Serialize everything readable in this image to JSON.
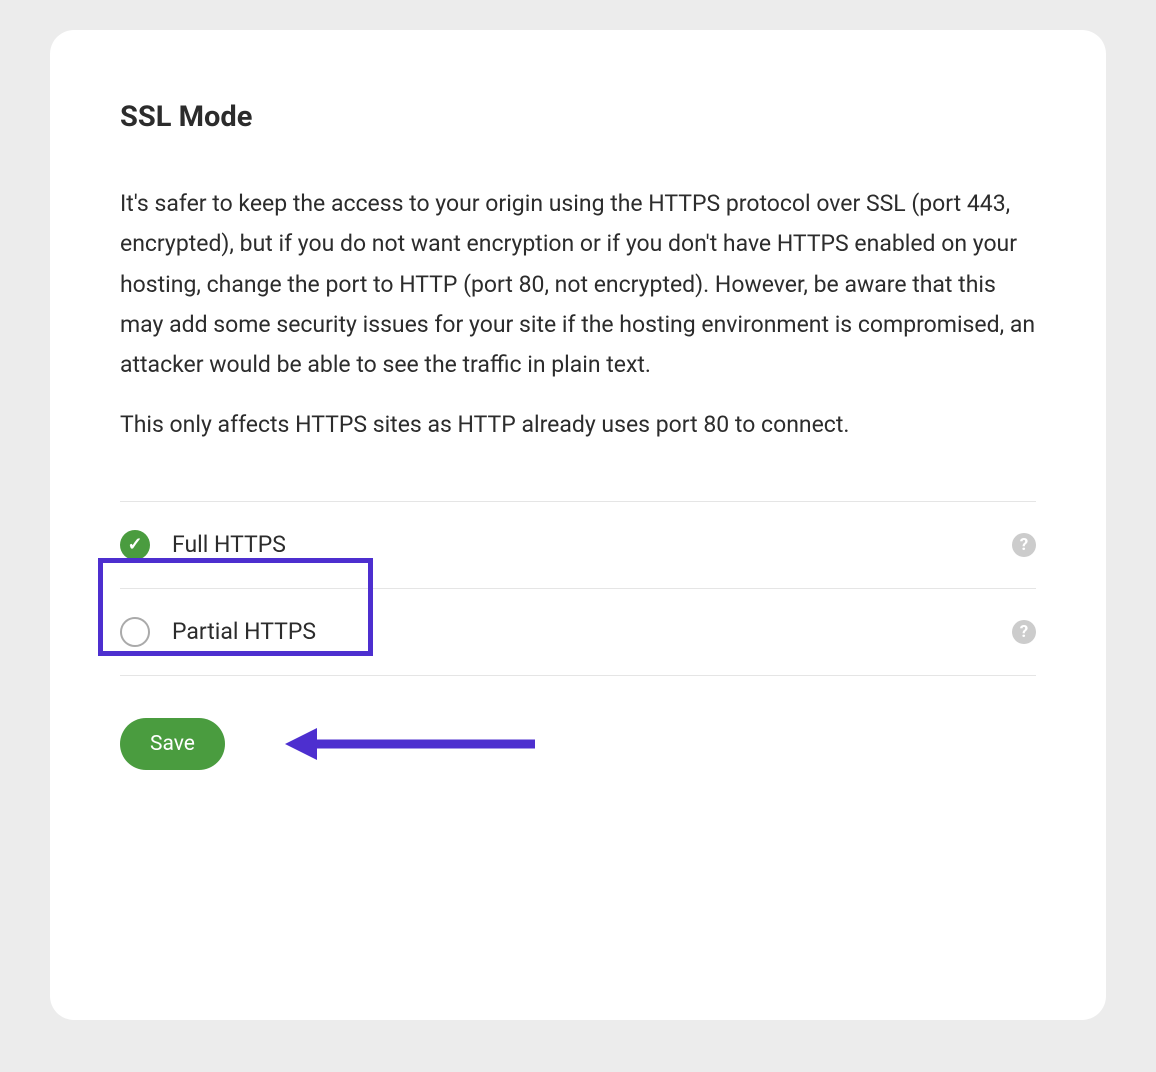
{
  "colors": {
    "accent_purple": "#4d2fcf",
    "accent_green": "#4a9c3f"
  },
  "card": {
    "title": "SSL Mode",
    "description1": "It's safer to keep the access to your origin using the HTTPS protocol over SSL (port 443, encrypted), but if you do not want encryption or if you don't have HTTPS enabled on your hosting, change the port to HTTP (port 80, not encrypted). However, be aware that this may add some security issues for your site if the hosting environment is compromised, an attacker would be able to see the traffic in plain text.",
    "description2": "This only affects HTTPS sites as HTTP already uses port 80 to connect."
  },
  "options": [
    {
      "label": "Full HTTPS",
      "checked": true
    },
    {
      "label": "Partial HTTPS",
      "checked": false
    }
  ],
  "actions": {
    "save_label": "Save"
  }
}
